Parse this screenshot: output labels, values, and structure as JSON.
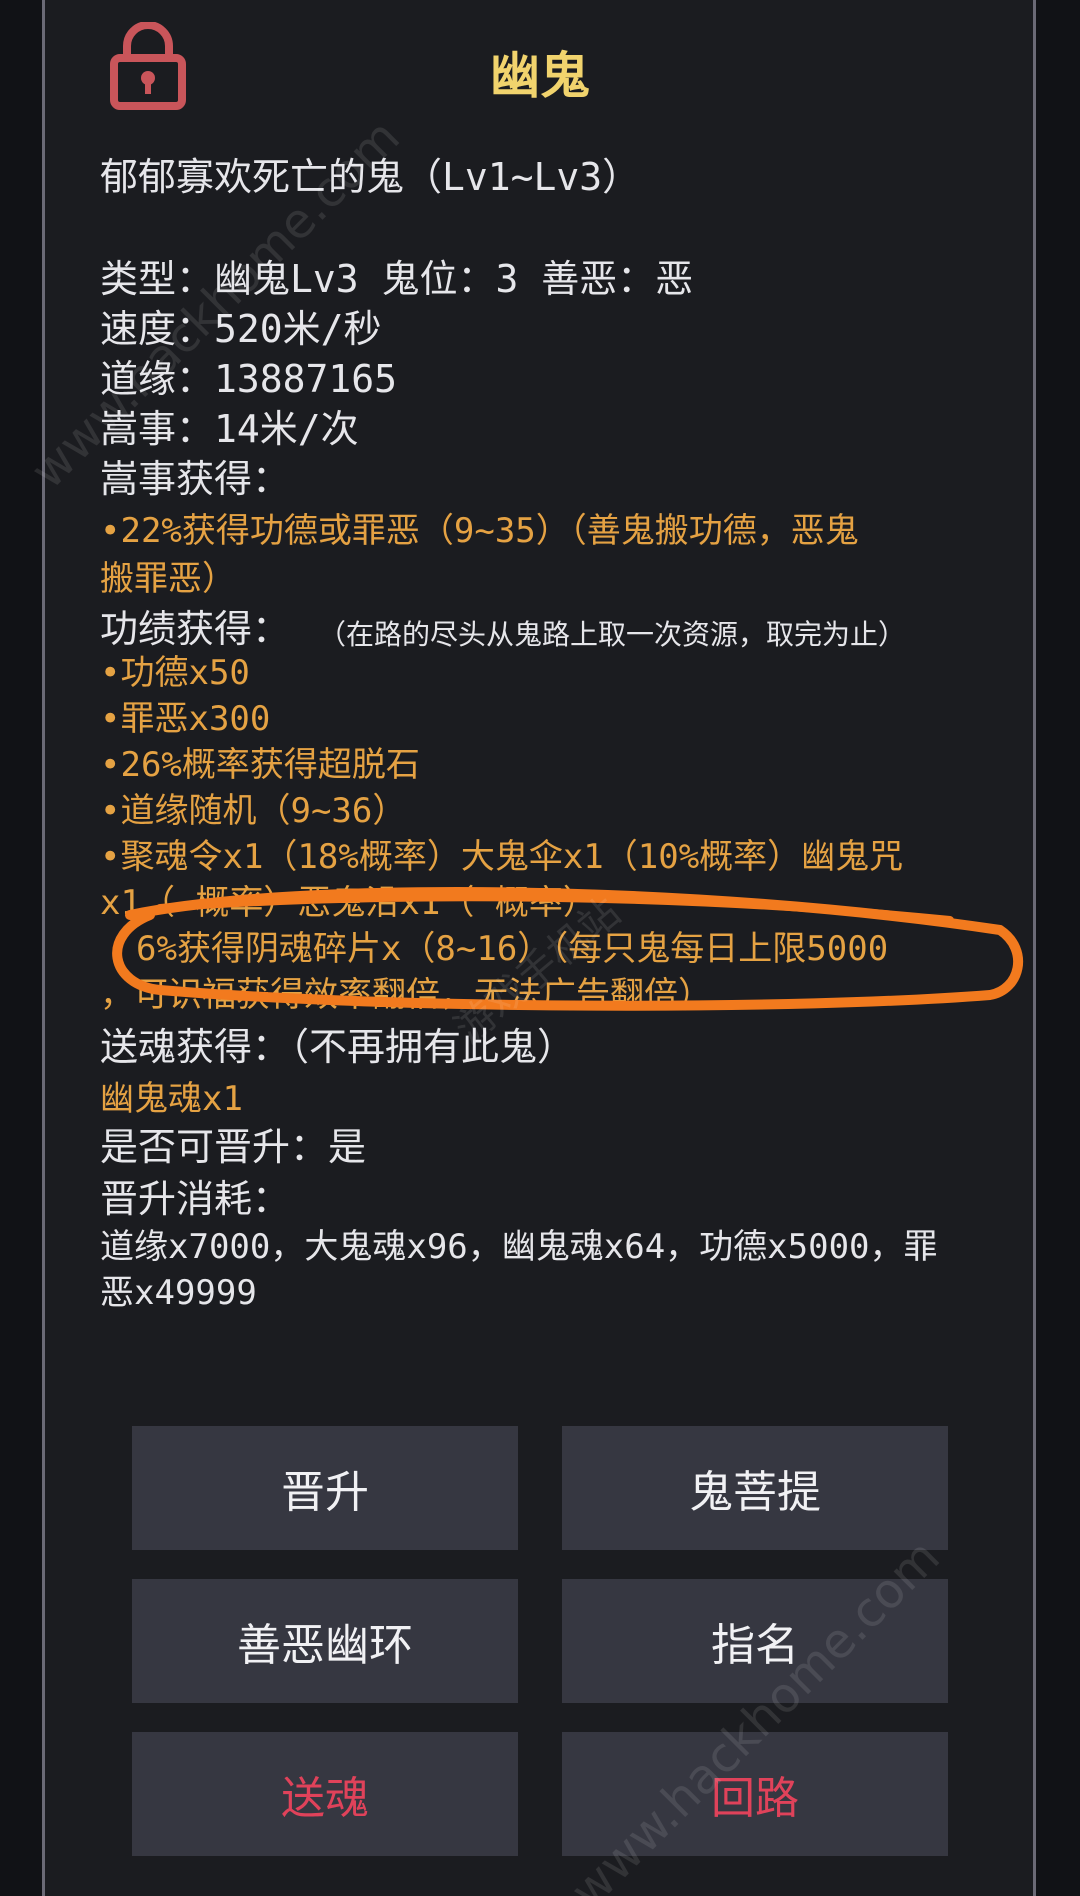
{
  "header": {
    "title": "幽鬼",
    "lock_icon": "lock-icon"
  },
  "description": "郁郁寡欢死亡的鬼（Lv1~Lv3）",
  "stats": {
    "type_line": "类型：幽鬼Lv3  鬼位：3  善恶：恶",
    "speed_line": "速度：520米/秒",
    "daoyuan_line": "道缘：13887165",
    "event_line": "嵩事：14米/次",
    "event_gain_title": "嵩事获得：",
    "event_gain_1": "•22%获得功德或罪恶（9~35）（善鬼搬功德，恶鬼",
    "event_gain_2": "搬罪恶）",
    "merit_title": "功绩获得：",
    "merit_note": "（在路的尽头从鬼路上取一次资源，取完为止）",
    "merit_items": [
      "•功德x50",
      "•罪恶x300",
      "•26%概率获得超脱石",
      "•道缘随机（9~36）",
      "•聚魂令x1（18%概率）大鬼伞x1（10%概率）幽鬼咒",
      "x1（  概率）恶鬼沿x1（  概率）",
      "6%获得阴魂碎片x（8~16）（每只鬼每日上限5000",
      "，可识福获得效率翻倍，无法广告翻倍）"
    ],
    "send_title": "送魂获得：（不再拥有此鬼）",
    "send_item": "幽鬼魂x1",
    "promote_line": "是否可晋升：是",
    "cost_title": "晋升消耗：",
    "cost_1": "道缘x7000，大鬼魂x96，幽鬼魂x64，功德x5000，罪",
    "cost_2": "恶x49999"
  },
  "buttons": {
    "promote": "晋升",
    "bodhi": "鬼菩提",
    "ring": "善恶幽环",
    "assign": "指名",
    "send": "送魂",
    "return": "回路"
  },
  "colors": {
    "title": "#f1d36d",
    "orange": "#e5a243",
    "red": "#e0425a",
    "annotation": "#f27a1e"
  },
  "watermark": {
    "text_1": "www.hackhome.com",
    "text_2": "www.hackhome.com",
    "text_3": "游戏手机站"
  }
}
